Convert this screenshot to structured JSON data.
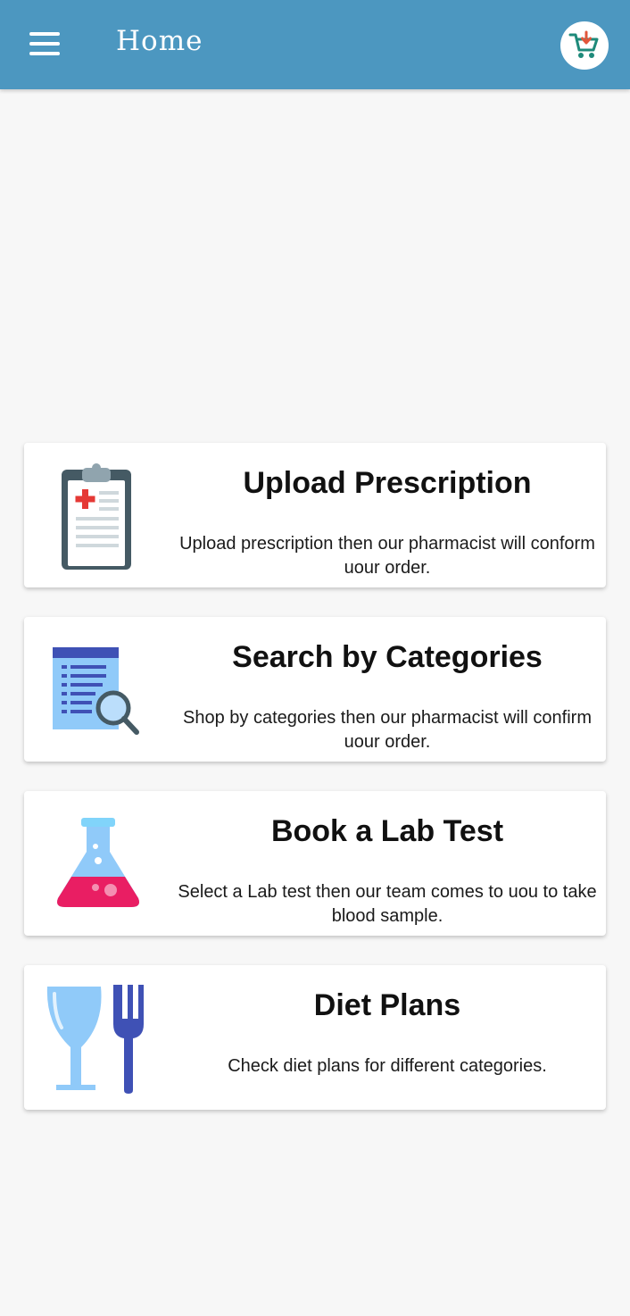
{
  "appbar": {
    "title": "Home",
    "menu_icon": "hamburger-menu-icon",
    "cart_icon": "cart-download-icon",
    "color": "#4c97c0"
  },
  "cards": [
    {
      "title": "Upload Prescription",
      "description": "Upload prescription then our pharmacist will conform uour order.",
      "icon": "prescription-clipboard-icon"
    },
    {
      "title": "Search by Categories",
      "description": "Shop by categories then our pharmacist will confirm uour order.",
      "icon": "list-search-icon"
    },
    {
      "title": "Book a Lab Test",
      "description": "Select a Lab test then our team comes to uou to take blood sample.",
      "icon": "lab-flask-icon"
    },
    {
      "title": "Diet Plans",
      "description": "Check diet plans for different categories.",
      "icon": "glass-fork-icon"
    }
  ]
}
